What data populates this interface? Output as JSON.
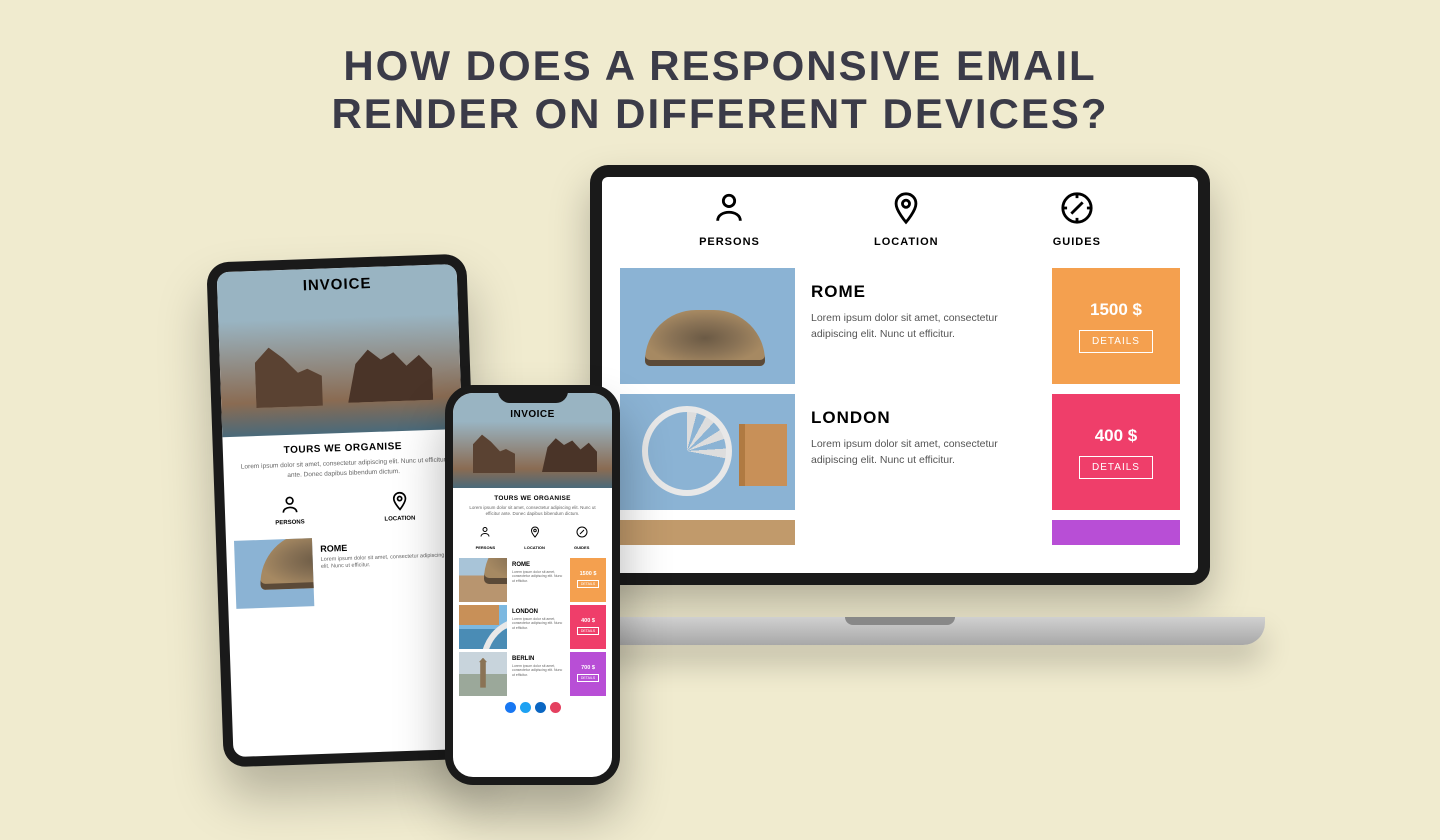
{
  "title_line1": "HOW DOES A RESPONSIVE EMAIL",
  "title_line2": "RENDER ON DIFFERENT DEVICES?",
  "email": {
    "invoice_label": "INVOICE",
    "section_heading": "TOURS WE ORGANISE",
    "section_text": "Lorem ipsum dolor sit amet, consectetur adipiscing elit. Nunc ut efficitur ante. Donec dapibus bibendum dictum.",
    "icons": {
      "persons": "PERSONS",
      "location": "LOCATION",
      "guides": "GUIDES"
    },
    "desc": "Lorem ipsum dolor sit amet, consectetur adipiscing elit. Nunc ut efficitur.",
    "details_label": "DETAILS",
    "tours": [
      {
        "city": "ROME",
        "price": "1500 $",
        "color": "#f4a04f"
      },
      {
        "city": "LONDON",
        "price": "400 $",
        "color": "#ef3e6a"
      },
      {
        "city": "BERLIN",
        "price": "700 $",
        "color": "#b84ed6"
      }
    ],
    "social_colors": [
      "#1877f2",
      "#1da1f2",
      "#0a66c2",
      "#e4405f"
    ]
  }
}
